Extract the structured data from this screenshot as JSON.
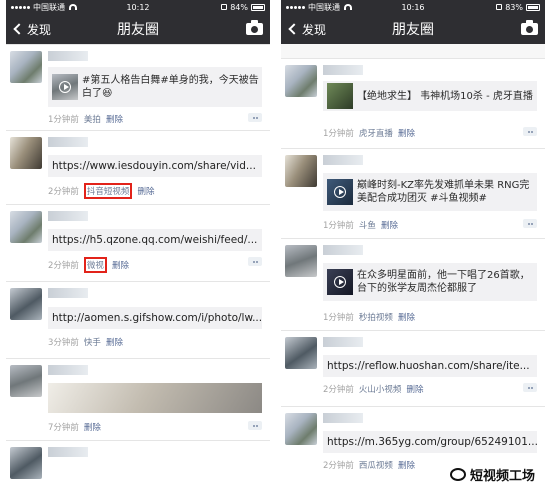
{
  "left": {
    "status": {
      "carrier": "中国联通",
      "time": "10:12",
      "battery": "84%",
      "battery_level": 0.84
    },
    "nav": {
      "back_label": "发现",
      "title": "朋友圈"
    },
    "posts": [
      {
        "card_text": "#第五人格告白舞#单身的我，今天被告白了😆",
        "time": "1分钟前",
        "source": "美拍",
        "delete": "删除"
      },
      {
        "card_url": "https://www.iesdouyin.com/share/vid...",
        "time": "2分钟前",
        "source": "抖音短视频",
        "delete": "删除"
      },
      {
        "card_url": "https://h5.qzone.qq.com/weishi/feed/...",
        "time": "2分钟前",
        "source": "微视",
        "delete": "删除"
      },
      {
        "card_url": "http://aomen.s.gifshow.com/i/photo/lw...",
        "time": "3分钟前",
        "source": "快手",
        "delete": "删除"
      },
      {
        "time": "7分钟前",
        "delete": "删除"
      }
    ]
  },
  "right": {
    "status": {
      "carrier": "中国联通",
      "time": "10:16",
      "battery": "83%",
      "battery_level": 0.83
    },
    "nav": {
      "back_label": "发现",
      "title": "朋友圈"
    },
    "posts": [
      {
        "card_text": "【绝地求生】 韦神机场10杀 - 虎牙直播",
        "time": "1分钟前",
        "source": "虎牙直播",
        "delete": "删除"
      },
      {
        "card_text": "巅峰时刻-KZ率先发难抓单未果 RNG完美配合成功团灭 #斗鱼视频#",
        "time": "1分钟前",
        "source": "斗鱼",
        "delete": "删除"
      },
      {
        "card_text": "在众多明星面前，他一下唱了26首歌，台下的张学友周杰伦都服了",
        "time": "1分钟前",
        "source": "秒拍视频",
        "delete": "删除"
      },
      {
        "card_url": "https://reflow.huoshan.com/share/ite...",
        "time": "2分钟前",
        "source": "火山小视频",
        "delete": "删除"
      },
      {
        "card_url": "https://m.365yg.com/group/65249101...",
        "time": "2分钟前",
        "source": "西瓜视频",
        "delete": "删除"
      }
    ],
    "watermark": "短视频工场"
  },
  "colors": {
    "nav_bg": "#2e2e32",
    "link": "#576b95",
    "highlight_box": "#e2231a"
  }
}
